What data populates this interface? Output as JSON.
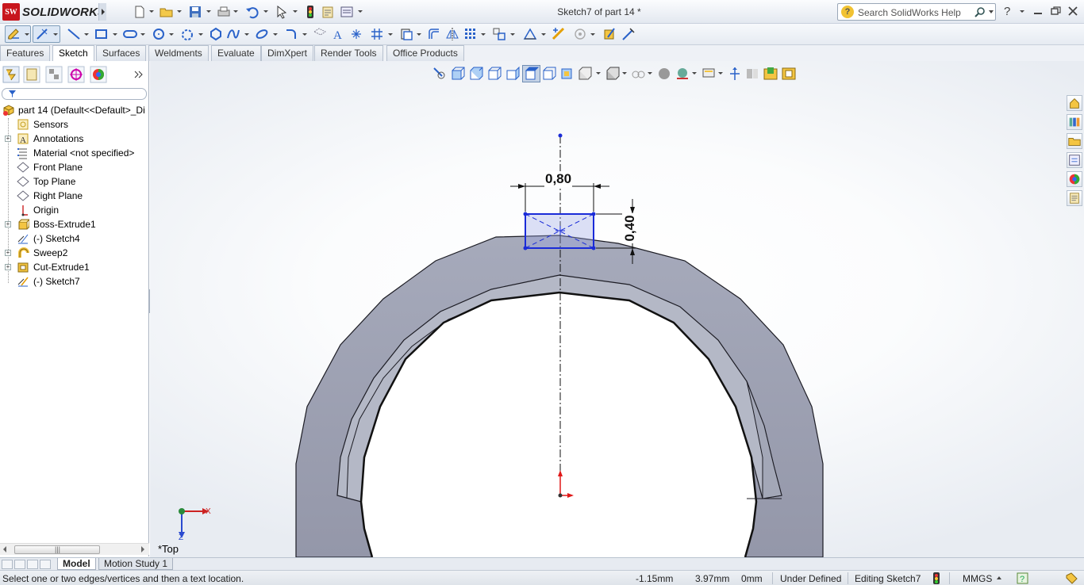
{
  "app": {
    "brand": "SOLIDWORKS",
    "brand_badge": "SW"
  },
  "window": {
    "title": "Sketch7 of part 14 *"
  },
  "search": {
    "placeholder": "Search SolidWorks Help"
  },
  "help": {
    "label": "?"
  },
  "tabs": [
    {
      "label": "Features"
    },
    {
      "label": "Sketch"
    },
    {
      "label": "Surfaces"
    },
    {
      "label": "Weldments"
    },
    {
      "label": "Evaluate"
    },
    {
      "label": "DimXpert"
    },
    {
      "label": "Render Tools"
    },
    {
      "label": "Office Products"
    }
  ],
  "active_tab": "Sketch",
  "feature_tree": {
    "root": "part 14  (Default<<Default>_Di",
    "items": [
      {
        "label": "Sensors",
        "icon": "sensors-icon",
        "expandable": false
      },
      {
        "label": "Annotations",
        "icon": "annotations-icon",
        "expandable": true
      },
      {
        "label": "Material <not specified>",
        "icon": "material-icon",
        "expandable": false
      },
      {
        "label": "Front Plane",
        "icon": "plane-icon",
        "expandable": false
      },
      {
        "label": "Top Plane",
        "icon": "plane-icon",
        "expandable": false
      },
      {
        "label": "Right Plane",
        "icon": "plane-icon",
        "expandable": false
      },
      {
        "label": "Origin",
        "icon": "origin-icon",
        "expandable": false
      },
      {
        "label": "Boss-Extrude1",
        "icon": "boss-extrude-icon",
        "expandable": true
      },
      {
        "label": "(-) Sketch4",
        "icon": "sketch-icon",
        "expandable": false
      },
      {
        "label": "Sweep2",
        "icon": "sweep-icon",
        "expandable": true
      },
      {
        "label": "Cut-Extrude1",
        "icon": "cut-extrude-icon",
        "expandable": true
      },
      {
        "label": "(-) Sketch7",
        "icon": "sketch-icon",
        "expandable": false
      }
    ]
  },
  "sketch": {
    "dim_horizontal": "0,80",
    "dim_vertical": "0,40"
  },
  "triad": {
    "x_label": "X",
    "z_label": "Z"
  },
  "view": {
    "label": "*Top"
  },
  "bottom_tabs": [
    {
      "label": "Model"
    },
    {
      "label": "Motion Study 1"
    }
  ],
  "status": {
    "message": "Select one or two edges/vertices and then a text location.",
    "x": "-1.15mm",
    "y": "3.97mm",
    "z": "0mm",
    "state": "Under Defined",
    "editing": "Editing Sketch7",
    "units": "MMGS"
  },
  "colors": {
    "brand_red": "#c8161d",
    "part_face": "#9ea3b3",
    "sketch_blue": "#1a2bd8",
    "accent_blue": "#2a62c9"
  }
}
